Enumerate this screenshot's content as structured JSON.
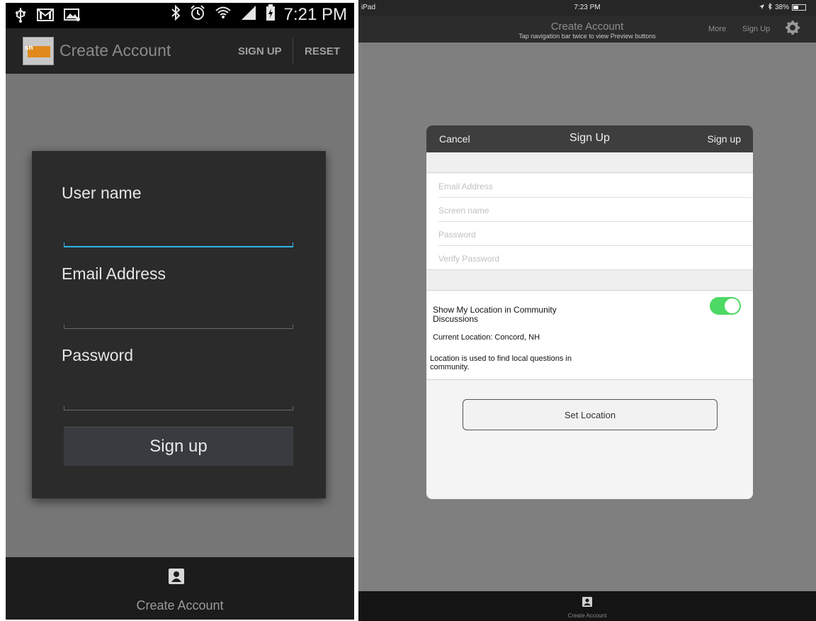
{
  "android": {
    "status_time": "7:21 PM",
    "title": "Create Account",
    "logo_text": "sn",
    "action_signup": "SIGN UP",
    "action_reset": "RESET",
    "form": {
      "username_label": "User name",
      "email_label": "Email Address",
      "password_label": "Password",
      "signup_button": "Sign up"
    },
    "tab_label": "Create Account"
  },
  "ipad": {
    "status_carrier": "iPad",
    "status_time": "7:23 PM",
    "status_battery": "38%",
    "nav_title": "Create Account",
    "nav_hint": "Tap navigation bar twice to view Preview buttons",
    "nav_more": "More",
    "nav_signup": "Sign Up",
    "modal": {
      "cancel": "Cancel",
      "title": "Sign Up",
      "signup": "Sign up",
      "fields": [
        {
          "placeholder": "Email Address"
        },
        {
          "placeholder": "Screen name"
        },
        {
          "placeholder": "Password"
        },
        {
          "placeholder": "Verify Password"
        }
      ],
      "location_label": "Show My Location in Community Discussions",
      "location_toggle_on": true,
      "current_location": "Current Location: Concord, NH",
      "location_note": "Location is used to find local questions in community.",
      "set_location_button": "Set Location"
    },
    "tab_label": "Create Account"
  },
  "colors": {
    "android_accent": "#33b5e5",
    "ios_toggle_on": "#4cd964"
  },
  "icons": [
    "usb-icon",
    "gmail-icon",
    "image-notification-icon",
    "bluetooth-icon",
    "alarm-icon",
    "wifi-icon",
    "signal-icon",
    "battery-charging-icon",
    "gear-icon",
    "person-icon"
  ]
}
